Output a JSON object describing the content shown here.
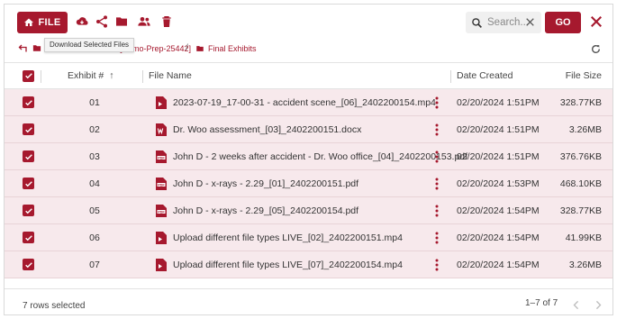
{
  "toolbar": {
    "file_label": "FILE",
    "icons": [
      "cloud-upload-icon",
      "share-icon",
      "folder-icon",
      "users-icon",
      "trash-icon"
    ],
    "tooltip": "Download Selected Files",
    "search_placeholder": "Search...",
    "go_label": "GO"
  },
  "breadcrumb": {
    "case_label": "[Demo-Prep-25442]",
    "separator": "/",
    "current": "Final Exhibits"
  },
  "table": {
    "headers": {
      "exhibit": "Exhibit #",
      "sort_arrow": "↑",
      "file_name": "File Name",
      "date": "Date Created",
      "size": "File Size"
    },
    "rows": [
      {
        "num": "01",
        "name": "2023-07-19_17-00-31 - accident scene_[06]_2402200154.mp4",
        "type": "video",
        "date": "02/20/2024 1:51PM",
        "size": "328.77KB"
      },
      {
        "num": "02",
        "name": "Dr. Woo assessment_[03]_2402200151.docx",
        "type": "word",
        "date": "02/20/2024 1:51PM",
        "size": "3.26MB"
      },
      {
        "num": "03",
        "name": "John D - 2 weeks after accident - Dr. Woo office_[04]_2402200153.pdf",
        "type": "pdf",
        "date": "02/20/2024 1:51PM",
        "size": "376.76KB"
      },
      {
        "num": "04",
        "name": "John D - x-rays - 2.29_[01]_2402200151.pdf",
        "type": "pdf",
        "date": "02/20/2024 1:53PM",
        "size": "468.10KB"
      },
      {
        "num": "05",
        "name": "John D - x-rays - 2.29_[05]_2402200154.pdf",
        "type": "pdf",
        "date": "02/20/2024 1:54PM",
        "size": "328.77KB"
      },
      {
        "num": "06",
        "name": "Upload different file types LIVE_[02]_2402200151.mp4",
        "type": "video",
        "date": "02/20/2024 1:54PM",
        "size": "41.99KB"
      },
      {
        "num": "07",
        "name": "Upload different file types LIVE_[07]_2402200154.mp4",
        "type": "video",
        "date": "02/20/2024 1:54PM",
        "size": "3.26MB"
      }
    ]
  },
  "footer": {
    "selected": "7 rows selected",
    "pager": "1–7 of 7"
  },
  "colors": {
    "accent": "#a6192e",
    "row_selected": "#f7e9ec"
  }
}
